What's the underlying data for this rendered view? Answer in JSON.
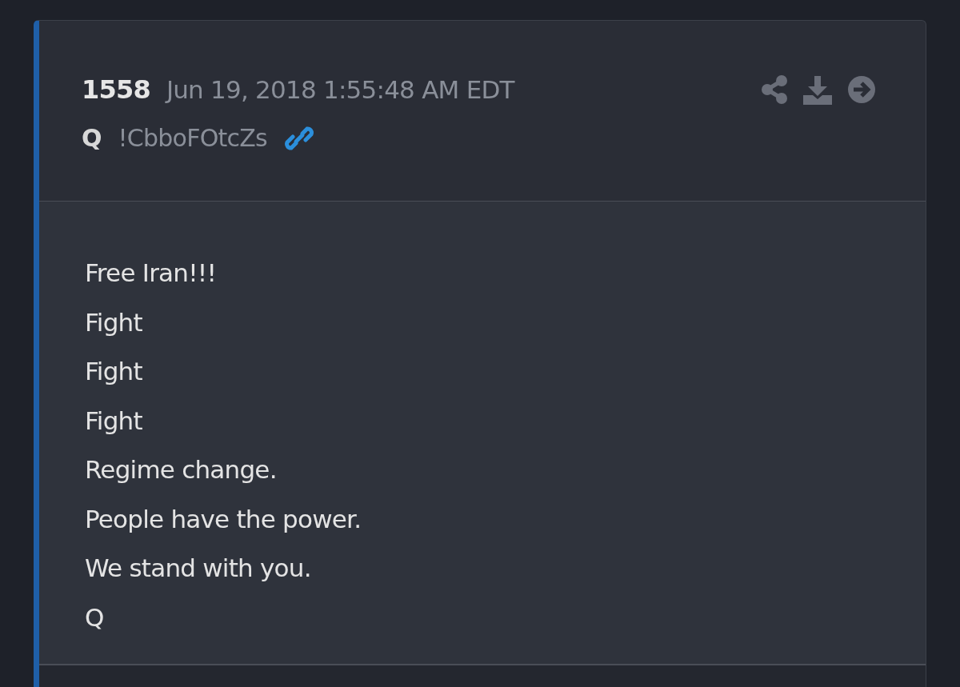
{
  "post": {
    "number": "1558",
    "date": "Jun 19, 2018 1:55:48 AM EDT",
    "author": "Q",
    "tripcode": "!CbboFOtcZs",
    "lines": [
      "Free Iran!!!",
      "Fight",
      "Fight",
      "Fight",
      "Regime change.",
      "People have the power.",
      "We stand with you.",
      "Q"
    ]
  }
}
